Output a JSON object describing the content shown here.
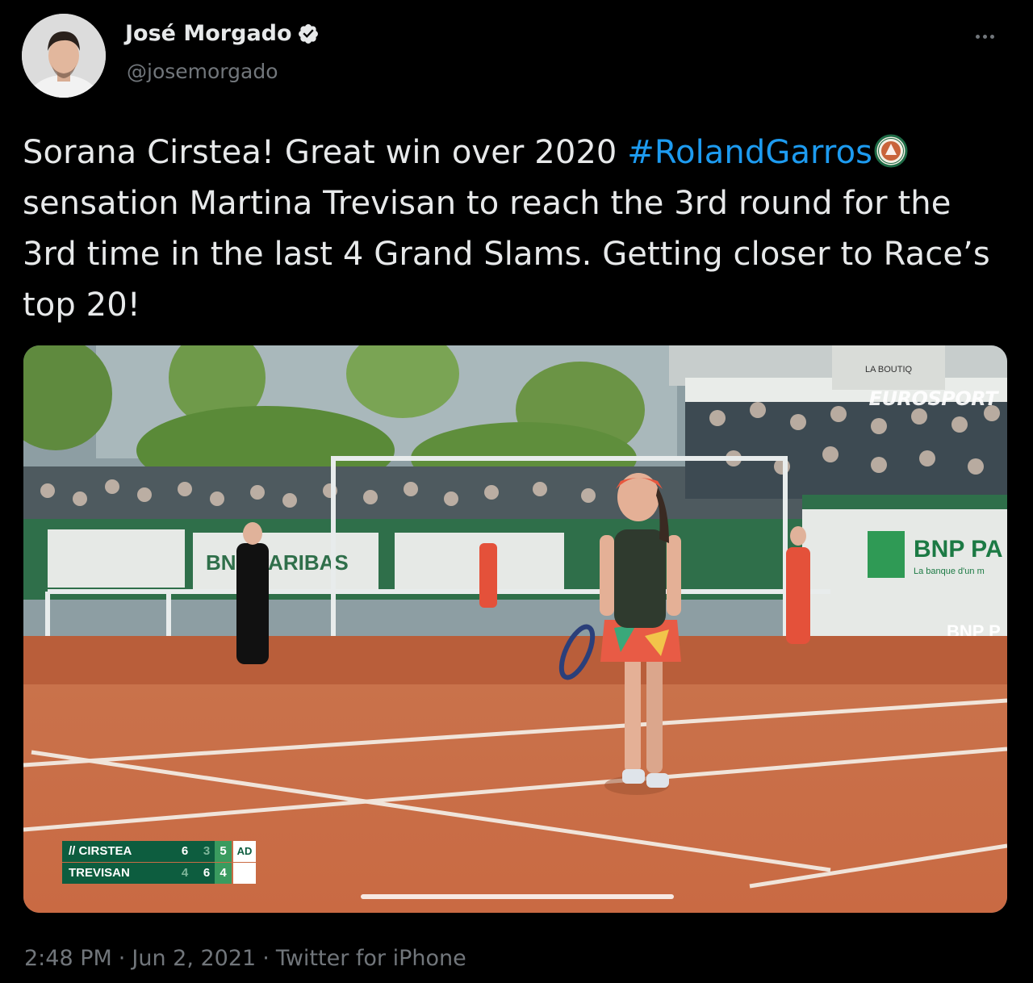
{
  "author": {
    "display_name": "José Morgado",
    "handle": "@josemorgado",
    "verified": true,
    "avatar_icon": "profile-photo"
  },
  "more_icon": "more-options-icon",
  "tweet": {
    "text_before": "Sorana Cirstea! Great win over 2020 ",
    "hashtag": "#RolandGarros",
    "text_after": " sensation Martina Trevisan to reach the 3rd round for the 3rd time in the last 4 Grand Slams. Getting closer to Race’s top 20!",
    "hashflag_icon": "roland-garros-logo"
  },
  "media": {
    "type": "video",
    "channel": "EUROSPORT",
    "sign_text": "LA BOUTIQ",
    "ads": [
      "BNP PARIBAS",
      "BNP PA",
      "La banque d'un m",
      "BNP P"
    ],
    "scoreboard": {
      "rows": [
        {
          "serve_marker": "//",
          "name": "CIRSTEA",
          "set1": "6",
          "set2": "3",
          "set3": "5",
          "points": "AD"
        },
        {
          "serve_marker": "",
          "name": "TREVISAN",
          "set1": "4",
          "set2": "6",
          "set3": "4",
          "points": ""
        }
      ]
    },
    "progress": 0.0
  },
  "meta": {
    "time": "2:48 PM",
    "date": "Jun 2, 2021",
    "source": "Twitter for iPhone"
  },
  "colors": {
    "background": "#000000",
    "text": "#e7e9ea",
    "secondary": "#71767b",
    "link": "#1d9bf0",
    "clay": "#c96a43",
    "scoreboard_green": "#0d5d3f"
  }
}
